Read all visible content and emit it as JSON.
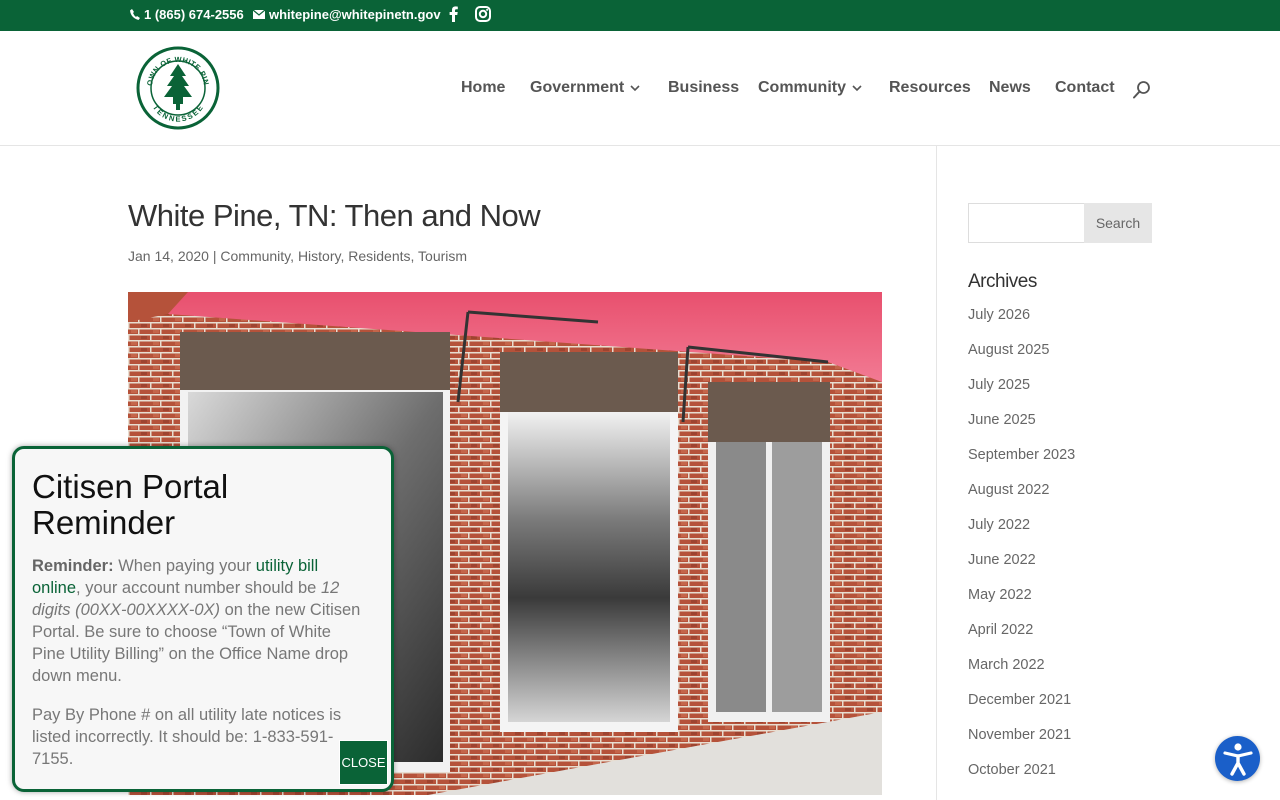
{
  "topbar": {
    "phone": "1 (865) 674-2556",
    "email": "whitepine@whitepinetn.gov"
  },
  "logo": {
    "top_text": "TOWN OF WHITE PINE",
    "bottom_text": "TENNESSEE"
  },
  "nav": {
    "items": [
      {
        "label": "Home",
        "has_dropdown": false
      },
      {
        "label": "Government",
        "has_dropdown": true
      },
      {
        "label": "Business",
        "has_dropdown": false
      },
      {
        "label": "Community",
        "has_dropdown": true
      },
      {
        "label": "Resources",
        "has_dropdown": false
      },
      {
        "label": "News",
        "has_dropdown": false
      },
      {
        "label": "Contact",
        "has_dropdown": false
      }
    ]
  },
  "post": {
    "title": "White Pine, TN: Then and Now",
    "date": "Jan 14, 2020",
    "separator": " | ",
    "categories": [
      "Community",
      "History",
      "Residents",
      "Tourism"
    ]
  },
  "sidebar": {
    "search_value": "",
    "search_button": "Search",
    "archives_title": "Archives",
    "archives": [
      "July 2026",
      "August 2025",
      "July 2025",
      "June 2025",
      "September 2023",
      "August 2022",
      "July 2022",
      "June 2022",
      "May 2022",
      "April 2022",
      "March 2022",
      "December 2021",
      "November 2021",
      "October 2021"
    ]
  },
  "popup": {
    "title": "Citisen Portal Reminder",
    "reminder_label": "Reminder:",
    "text_1": " When paying your ",
    "link_text": "utility bill online",
    "text_2": ", your account number should be ",
    "format_text": "12 digits (00XX-00XXXX-0X)",
    "text_3": " on the new Citisen Portal. Be sure to choose “Town of White Pine Utility Billing” on the Office Name drop down menu.",
    "paragraph_2": "Pay By Phone # on all utility late notices is listed incorrectly. It should be: 1-833-591-7155.",
    "close_label": "CLOSE"
  },
  "colors": {
    "brand_green": "#0a6337",
    "accessibility_blue": "#1a5fc9"
  },
  "icons": {
    "phone": "phone-icon",
    "email": "envelope-icon",
    "facebook": "facebook-icon",
    "instagram": "instagram-icon",
    "search": "search-icon",
    "accessibility": "accessibility-icon"
  }
}
